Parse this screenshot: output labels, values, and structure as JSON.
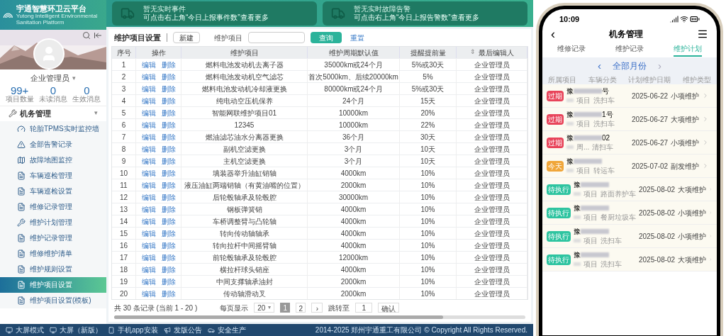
{
  "logo": {
    "title": "宇通智慧环卫云平台",
    "subtitle": "Yutong Intelligent Environmental Sanitation Platform"
  },
  "banners": [
    {
      "title": "暂无实时事件",
      "hint": "可点击右上角“今日上报事件数”查看更多"
    },
    {
      "title": "暂无实时故障告警",
      "hint": "可点击右上角“今日上报告警数”查看更多"
    }
  ],
  "user": {
    "name": "企业管理员",
    "caret": "▾"
  },
  "stats": [
    {
      "value": "99+",
      "label": "项目数量"
    },
    {
      "value": "0",
      "label": "未读消息"
    },
    {
      "value": "0",
      "label": "生效消息"
    }
  ],
  "menu": {
    "group": "机务管理",
    "caret": "▾",
    "expanded": true,
    "items": [
      {
        "label": "轮胎TPMS实时监控墙",
        "selected": false
      },
      {
        "label": "全部告警记录",
        "selected": false
      },
      {
        "label": "故障地图监控",
        "selected": false
      },
      {
        "label": "车辆巡检管理",
        "selected": false
      },
      {
        "label": "车辆巡检设置",
        "selected": false
      },
      {
        "label": "维修记录管理",
        "selected": false
      },
      {
        "label": "维护计划管理",
        "selected": false
      },
      {
        "label": "维护记录管理",
        "selected": false
      },
      {
        "label": "维修维护清单",
        "selected": false
      },
      {
        "label": "维护规则设置",
        "selected": false
      },
      {
        "label": "维护项目设置",
        "selected": true
      },
      {
        "label": "维护项目设置(模板)",
        "selected": false
      }
    ]
  },
  "toolbar": {
    "title": "维护项目设置",
    "new_button": "新建",
    "field_label": "维护项目",
    "search_button": "查询",
    "reset_button": "重置"
  },
  "table": {
    "columns": [
      "序号",
      "操作",
      "维护项目",
      "维护周期默认值",
      "提醒提前量",
      "最后编辑人"
    ],
    "sort_icon": "⇕",
    "rows": [
      [
        "1",
        [
          "编辑",
          "删除"
        ],
        "燃料电池发动机去离子器",
        "35000km或24个月",
        "5%或30天",
        "企业管理员"
      ],
      [
        "2",
        [
          "编辑",
          "删除"
        ],
        "燃料电池发动机空气滤芯",
        "首次5000km、后续20000km",
        "5%",
        "企业管理员"
      ],
      [
        "3",
        [
          "编辑",
          "删除"
        ],
        "燃料电池发动机冷却液更换",
        "80000km或24个月",
        "5%或30天",
        "企业管理员"
      ],
      [
        "4",
        [
          "编辑",
          "删除"
        ],
        "纯电动空压机保养",
        "24个月",
        "15天",
        "企业管理员"
      ],
      [
        "5",
        [
          "编辑",
          "删除"
        ],
        "智能网联维护项目01",
        "10000km",
        "20%",
        "企业管理员"
      ],
      [
        "6",
        [
          "编辑",
          "删除"
        ],
        "12345",
        "10000km",
        "22%",
        "企业管理员"
      ],
      [
        "7",
        [
          "编辑",
          "删除"
        ],
        "燃油滤芯油水分离器更换",
        "36个月",
        "30天",
        "企业管理员"
      ],
      [
        "8",
        [
          "编辑",
          "删除"
        ],
        "副机空滤更换",
        "3个月",
        "10天",
        "企业管理员"
      ],
      [
        "9",
        [
          "编辑",
          "删除"
        ],
        "主机空滤更换",
        "3个月",
        "10天",
        "企业管理员"
      ],
      [
        "10",
        [
          "编辑",
          "删除"
        ],
        "填装器举升油缸销轴",
        "4000km",
        "10%",
        "企业管理员"
      ],
      [
        "11",
        [
          "编辑",
          "删除"
        ],
        "液压油缸两端销轴（有黄油嘴的位置）",
        "2000km",
        "10%",
        "企业管理员"
      ],
      [
        "12",
        [
          "编辑",
          "删除"
        ],
        "后轮毂轴承及轮毂腔",
        "30000km",
        "10%",
        "企业管理员"
      ],
      [
        "13",
        [
          "编辑",
          "删除"
        ],
        "钢板弹簧销",
        "4000km",
        "10%",
        "企业管理员"
      ],
      [
        "14",
        [
          "编辑",
          "删除"
        ],
        "车桥调整臂与凸轮轴",
        "4000km",
        "10%",
        "企业管理员"
      ],
      [
        "15",
        [
          "编辑",
          "删除"
        ],
        "转向传动轴轴承",
        "4000km",
        "10%",
        "企业管理员"
      ],
      [
        "16",
        [
          "编辑",
          "删除"
        ],
        "转向拉杆中间摇臂轴",
        "4000km",
        "10%",
        "企业管理员"
      ],
      [
        "17",
        [
          "编辑",
          "删除"
        ],
        "前轮毂轴承及轮毂腔",
        "12000km",
        "10%",
        "企业管理员"
      ],
      [
        "18",
        [
          "编辑",
          "删除"
        ],
        "横拉杆球头销座",
        "4000km",
        "10%",
        "企业管理员"
      ],
      [
        "19",
        [
          "编辑",
          "删除"
        ],
        "中间支撑轴承油封",
        "2000km",
        "10%",
        "企业管理员"
      ],
      [
        "20",
        [
          "编辑",
          "删除"
        ],
        "传动轴滑动叉",
        "2000km",
        "10%",
        "企业管理员"
      ]
    ]
  },
  "pagination": {
    "summary": "共 30 条记录 (当前 1 - 20 )",
    "per_page_label": "每页显示",
    "per_page": "20",
    "per_page_caret": "▾",
    "pages": [
      {
        "label": "1",
        "selected": true
      },
      {
        "label": "2",
        "selected": false
      }
    ],
    "next": "›",
    "jump_label": "跳转至",
    "jump_value": "1",
    "confirm": "确认"
  },
  "footer": {
    "links": [
      "大屏模式",
      "大屏（新版）",
      "手机app安装",
      "发版公告",
      "安全生产"
    ],
    "copyright": "2014-2025 郑州宇通重工有限公司 © Copyright All Rights Reserved."
  },
  "phone": {
    "time": "10:09",
    "back": "‹",
    "title": "机务管理",
    "tabs": [
      {
        "label": "维修记录",
        "selected": false
      },
      {
        "label": "维护记录",
        "selected": false
      },
      {
        "label": "维护计划",
        "selected": true
      }
    ],
    "month": {
      "prev": "‹",
      "label": "全部月份",
      "next": "›"
    },
    "columns": [
      "所属项目",
      "车辆分类",
      "计划维护日期",
      "维护类型"
    ],
    "rows": [
      {
        "badge": "过期",
        "color": "#e8445a",
        "plate_prefix": "豫",
        "plate_suffix": "号",
        "project": "项目",
        "vehicle": "洗扫车",
        "date": "2025-06-22",
        "type": "小项维护"
      },
      {
        "badge": "过期",
        "color": "#e8445a",
        "plate_prefix": "豫",
        "plate_suffix": "1号",
        "project": "项目",
        "vehicle": "洗扫车",
        "date": "2025-06-27",
        "type": "大项维护"
      },
      {
        "badge": "过期",
        "color": "#e8445a",
        "plate_prefix": "豫",
        "plate_suffix": "02",
        "project": "周...",
        "vehicle": "清扫车",
        "date": "2025-06-27",
        "type": "小项维护"
      },
      {
        "badge": "今天",
        "color": "#f0a63a",
        "plate_prefix": "豫",
        "plate_suffix": "",
        "project": "项目",
        "vehicle": "转运车",
        "date": "2025-07-02",
        "type": "副发维护"
      },
      {
        "badge": "待执行",
        "color": "#2ec4a0",
        "plate_prefix": "豫",
        "plate_suffix": "",
        "project": "项目",
        "vehicle": "路面养护车",
        "date": "2025-08-02",
        "type": "大项维护"
      },
      {
        "badge": "待执行",
        "color": "#2ec4a0",
        "plate_prefix": "豫",
        "plate_suffix": "",
        "project": "项目",
        "vehicle": "餐厨垃圾车",
        "date": "2025-08-02",
        "type": "小项维护"
      },
      {
        "badge": "待执行",
        "color": "#2ec4a0",
        "plate_prefix": "豫",
        "plate_suffix": "",
        "project": "项目",
        "vehicle": "洗扫车",
        "date": "2025-08-02",
        "type": "小项维护"
      },
      {
        "badge": "待执行",
        "color": "#2ec4a0",
        "plate_prefix": "豫",
        "plate_suffix": "",
        "project": "项目",
        "vehicle": "洗扫车",
        "date": "2025-08-02",
        "type": "大项维护"
      }
    ]
  }
}
